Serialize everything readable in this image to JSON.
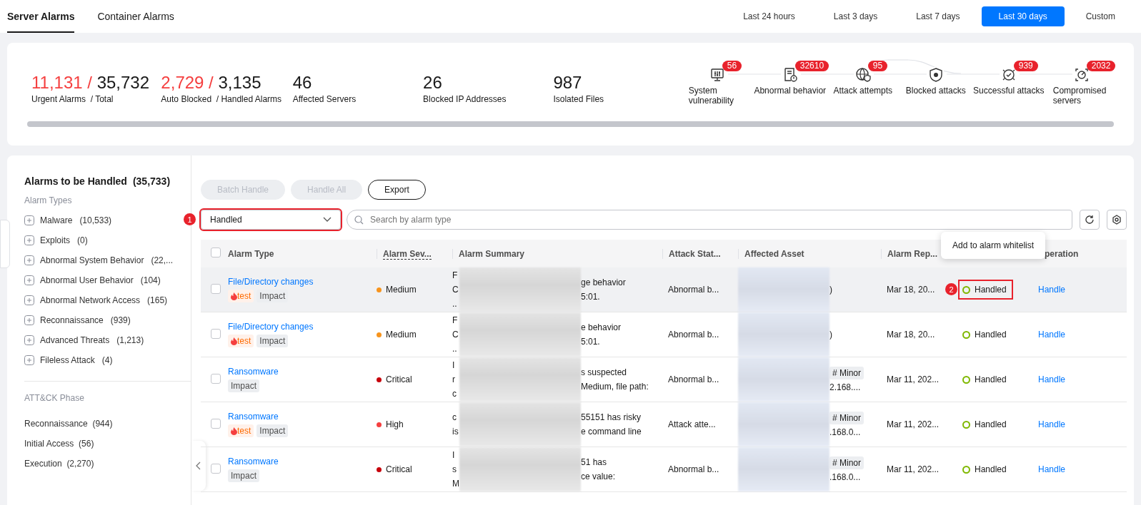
{
  "tabs": [
    {
      "label": "Server Alarms",
      "selected": true
    },
    {
      "label": "Container Alarms",
      "selected": false
    }
  ],
  "time_ranges": [
    {
      "label": "Last 24 hours",
      "selected": false
    },
    {
      "label": "Last 3 days",
      "selected": false
    },
    {
      "label": "Last 7 days",
      "selected": false
    },
    {
      "label": "Last 30 days",
      "selected": true
    },
    {
      "label": "Custom",
      "selected": false
    }
  ],
  "stats": [
    {
      "value": "11,131 /",
      "total": "35,732",
      "label": "Urgent Alarms  / Total"
    },
    {
      "value": "2,729 /",
      "total": "3,135",
      "label": "Auto Blocked  / Handled Alarms"
    },
    {
      "value": "46",
      "label": "Affected Servers"
    },
    {
      "value": "26",
      "label": "Blocked IP Addresses"
    },
    {
      "value": "987",
      "label": "Isolated Files"
    }
  ],
  "attack_chain": [
    {
      "kind": "monitor",
      "label": "System vulnerability",
      "count": "56"
    },
    {
      "kind": "document",
      "label": "Abnormal behavior",
      "count": "32610"
    },
    {
      "kind": "globe",
      "label": "Attack attempts",
      "count": "95"
    },
    {
      "kind": "shield",
      "label": "Blocked attacks"
    },
    {
      "kind": "check",
      "label": "Successful attacks",
      "count": "939"
    },
    {
      "kind": "target",
      "label": "Compromised servers",
      "count": "2032"
    }
  ],
  "sidebar": {
    "title": "Alarms to be Handled",
    "count": "(35,733)",
    "types_heading": "Alarm Types",
    "types": [
      {
        "label": "Malware",
        "count": "(10,533)"
      },
      {
        "label": "Exploits",
        "count": "(0)"
      },
      {
        "label": "Abnormal System Behavior",
        "count": "(22,..."
      },
      {
        "label": "Abnormal User Behavior",
        "count": "(104)"
      },
      {
        "label": "Abnormal Network Access",
        "count": "(165)"
      },
      {
        "label": "Reconnaissance",
        "count": "(939)"
      },
      {
        "label": "Advanced Threats",
        "count": "(1,213)"
      },
      {
        "label": "Fileless Attack",
        "count": "(4)"
      }
    ],
    "phase_heading": "ATT&CK Phase",
    "phases": [
      {
        "label": "Reconnaissance",
        "count": "(944)"
      },
      {
        "label": "Initial Access",
        "count": "(56)"
      },
      {
        "label": "Execution",
        "count": "(2,270)"
      }
    ]
  },
  "toolbar": {
    "buttons": [
      {
        "label": "Batch Handle",
        "disabled": true
      },
      {
        "label": "Handle All",
        "disabled": true
      },
      {
        "label": "Export",
        "disabled": false
      }
    ]
  },
  "filter": {
    "value": "Handled",
    "callout": "1"
  },
  "search": {
    "placeholder": "Search by alarm type"
  },
  "table": {
    "header_checked": false,
    "columns": [
      {
        "label": "Alarm Type",
        "dotted": false
      },
      {
        "label": "Alarm Sev...",
        "dotted": true
      },
      {
        "label": "Alarm Summary",
        "dotted": false
      },
      {
        "label": "Attack Stat...",
        "dotted": false
      },
      {
        "label": "Affected Asset",
        "dotted": false
      },
      {
        "label": "Alarm Rep...",
        "dotted": false
      },
      {
        "label": "peration",
        "dotted": false
      }
    ],
    "rows": [
      {
        "checked": false,
        "hovered": true,
        "type": "File/Directory changes",
        "tags": [
          {
            "kind": "flame",
            "label": "test"
          },
          {
            "kind": "plain",
            "label": "Impact"
          }
        ],
        "severity": "Medium",
        "color": "#f7941d",
        "summary_start": [
          "F",
          "C",
          ".."
        ],
        "summary_end": [
          "ge behavior",
          "5:01."
        ],
        "attack_status": "Abnormal b...",
        "asset_end": ")",
        "reported": "Mar 18, 20...",
        "status": "Handled",
        "status_callout": "2",
        "operation": "Handle"
      },
      {
        "checked": false,
        "hovered": false,
        "type": "File/Directory changes",
        "tags": [
          {
            "kind": "flame",
            "label": "test"
          },
          {
            "kind": "plain",
            "label": "Impact"
          }
        ],
        "severity": "Medium",
        "color": "#f7941d",
        "summary_start": [
          "F",
          "C",
          ".."
        ],
        "summary_end": [
          "e behavior",
          "5:01."
        ],
        "attack_status": "Abnormal b...",
        "asset_end": ")",
        "reported": "Mar 18, 20...",
        "status": "Handled",
        "operation": "Handle"
      },
      {
        "checked": false,
        "hovered": false,
        "type": "Ransomware",
        "tags": [
          {
            "kind": "plain",
            "label": "Impact"
          }
        ],
        "severity": "Critical",
        "color": "#c7000b",
        "summary_start": [
          "I",
          "r",
          "c"
        ],
        "summary_end": [
          "s suspected",
          "Medium, file path:"
        ],
        "attack_status": "Abnormal b...",
        "asset_tag": "# Minor",
        "asset_end": "2.168....",
        "reported": "Mar 11, 202...",
        "status": "Handled",
        "operation": "Handle"
      },
      {
        "checked": false,
        "hovered": false,
        "type": "Ransomware",
        "tags": [
          {
            "kind": "flame",
            "label": "test"
          },
          {
            "kind": "plain",
            "label": "Impact"
          }
        ],
        "severity": "High",
        "color": "#f53f3f",
        "summary_start": [
          "c",
          "is"
        ],
        "summary_end": [
          "55151 has risky",
          "e command line"
        ],
        "attack_status": "Attack atte...",
        "asset_tag": "# Minor",
        "asset_end": ".168.0...",
        "reported": "Mar 11, 202...",
        "status": "Handled",
        "operation": "Handle"
      },
      {
        "checked": false,
        "hovered": false,
        "type": "Ransomware",
        "tags": [
          {
            "kind": "plain",
            "label": "Impact"
          }
        ],
        "severity": "Critical",
        "color": "#c7000b",
        "summary_start": [
          "I",
          "s",
          "M"
        ],
        "summary_end": [
          "51 has",
          "ce value:"
        ],
        "attack_status": "Abnormal b...",
        "asset_tag": "# Minor",
        "asset_end": ".168.0...",
        "reported": "Mar 11, 202...",
        "status": "Handled",
        "operation": "Handle"
      }
    ]
  },
  "tooltip": "Add to alarm whitelist"
}
